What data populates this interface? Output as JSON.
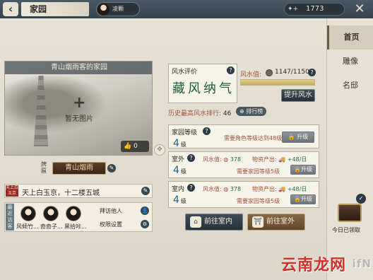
{
  "topbar": {
    "back_icon": "back-arrow-icon",
    "title": "家园",
    "player_name": "凌颗",
    "currency_value": "1773",
    "close_icon": "close-icon"
  },
  "side_tabs": [
    "首页",
    "雕像",
    "名邸"
  ],
  "photo": {
    "title": "青山烟雨客的家园",
    "no_photo": "暂无图片",
    "likes": "0"
  },
  "plaque": {
    "label": "牌匾",
    "name": "青山烟雨"
  },
  "motto": {
    "seal": "天上白玉京",
    "text": "天上白玉京，十二楼五城"
  },
  "visitors": {
    "tag": "最近访客",
    "names": [
      "风倾竹...",
      "奇奇子...",
      "黑拾咔..."
    ],
    "visit_label": "拜访他人",
    "permission_label": "权限设置"
  },
  "fengshui": {
    "title": "风水评价",
    "grade": "藏风纳气",
    "value_label": "风水值:",
    "value": "1147/1150",
    "value_ratio": 0.997,
    "upgrade_label": "提升风水",
    "history_label": "历史最高风水排行:",
    "history_value": "46",
    "rank_label": "排行榜"
  },
  "home_level": {
    "name": "家园等级",
    "level": "4",
    "level_unit": "级",
    "requirement": "需要角色等级达到48级",
    "button": "升级"
  },
  "outdoor": {
    "name": "室外",
    "level": "4",
    "level_unit": "级",
    "fs_label": "风水值:",
    "fs_value": "378",
    "output_label": "物资产出:",
    "output_value": "+48/日",
    "requirement": "需要家园等级5级",
    "button": "升级"
  },
  "indoor": {
    "name": "室内",
    "level": "4",
    "level_unit": "级",
    "fs_label": "风水值:",
    "fs_value": "378",
    "output_label": "物资产出:",
    "output_value": "+48/日",
    "requirement": "需要家园等级5级",
    "button": "升级"
  },
  "actions": {
    "indoor_btn": "前往室内",
    "outdoor_btn": "前往室外"
  },
  "daily": {
    "label": "今日已领取"
  },
  "watermark": {
    "text": "云南龙网",
    "suffix": "ifN"
  },
  "colors": {
    "accent_dark": "#2e3a44",
    "brown": "#8a6a45",
    "green_text": "#1f5d32"
  }
}
